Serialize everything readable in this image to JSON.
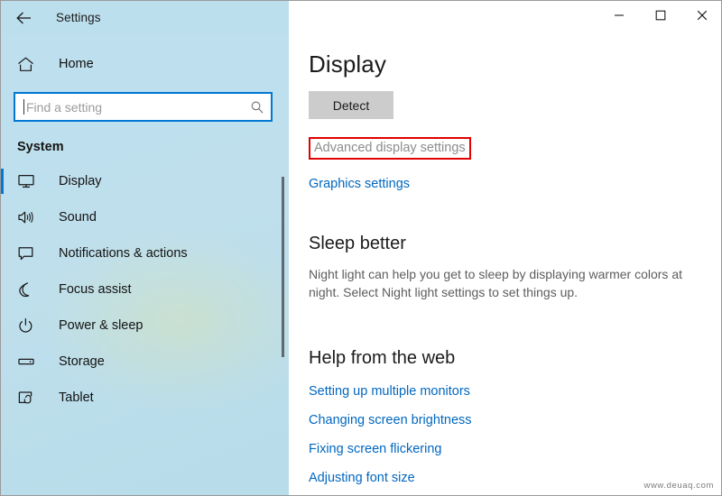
{
  "window": {
    "app_title": "Settings",
    "back_icon": "back-arrow-icon",
    "minimize_label": "─",
    "maximize_label": "□",
    "close_label": "✕"
  },
  "sidebar": {
    "home_label": "Home",
    "home_icon": "home-icon",
    "search": {
      "placeholder": "Find a setting",
      "value": "",
      "icon": "search-icon"
    },
    "section_label": "System",
    "items": [
      {
        "label": "Display",
        "icon": "monitor-icon",
        "selected": true
      },
      {
        "label": "Sound",
        "icon": "speaker-icon",
        "selected": false
      },
      {
        "label": "Notifications & actions",
        "icon": "chat-bubble-icon",
        "selected": false
      },
      {
        "label": "Focus assist",
        "icon": "moon-icon",
        "selected": false
      },
      {
        "label": "Power & sleep",
        "icon": "power-icon",
        "selected": false
      },
      {
        "label": "Storage",
        "icon": "drive-icon",
        "selected": false
      },
      {
        "label": "Tablet",
        "icon": "tablet-hand-icon",
        "selected": false
      }
    ]
  },
  "main": {
    "page_title": "Display",
    "detect_button": "Detect",
    "advanced_display_settings": "Advanced display settings",
    "graphics_settings": "Graphics settings",
    "sleep": {
      "heading": "Sleep better",
      "description": "Night light can help you get to sleep by displaying warmer colors at night. Select Night light settings to set things up."
    },
    "help": {
      "heading": "Help from the web",
      "links": [
        "Setting up multiple monitors",
        "Changing screen brightness",
        "Fixing screen flickering",
        "Adjusting font size"
      ]
    }
  },
  "watermark": "www.deuaq.com",
  "colors": {
    "accent": "#0078d4",
    "link": "#0067c0",
    "highlight_box": "#e30000",
    "sidebar": "#bddfee",
    "button": "#cccccc"
  }
}
